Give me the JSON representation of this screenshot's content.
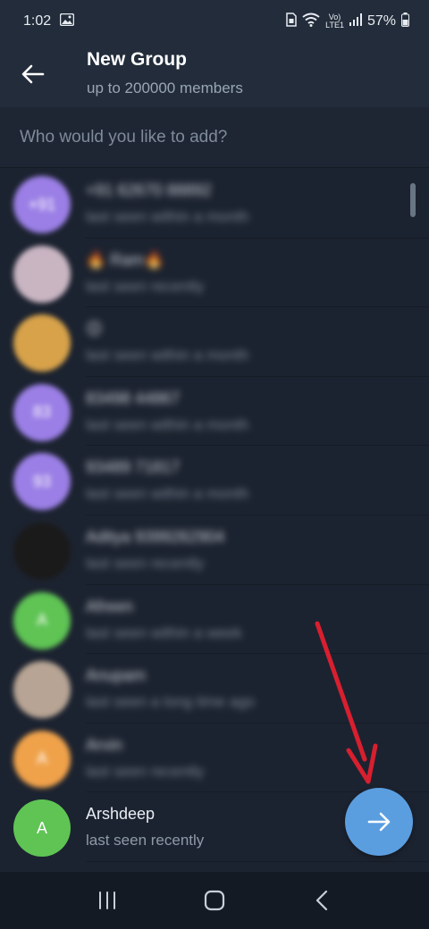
{
  "status_bar": {
    "time": "1:02",
    "volte_label": "Vo)",
    "lte_label": "LTE1",
    "battery": "57%"
  },
  "header": {
    "title": "New Group",
    "subtitle": "up to 200000 members"
  },
  "search": {
    "placeholder": "Who would you like to add?"
  },
  "contacts": [
    {
      "name": "+91 62670 88892",
      "status": "last seen within a month",
      "avatar_color": "#9b7fe6",
      "avatar_text": "+91",
      "blurred": true
    },
    {
      "name": "🔥 Ram🔥",
      "status": "last seen recently",
      "avatar_color": "#c9b5c2",
      "avatar_text": "",
      "blurred": true
    },
    {
      "name": "😊",
      "status": "last seen within a month",
      "avatar_color": "#d7a24a",
      "avatar_text": "",
      "blurred": true
    },
    {
      "name": "83498 44867",
      "status": "last seen within a month",
      "avatar_color": "#9b7fe6",
      "avatar_text": "83",
      "blurred": true
    },
    {
      "name": "93489 71817",
      "status": "last seen within a month",
      "avatar_color": "#9b7fe6",
      "avatar_text": "93",
      "blurred": true
    },
    {
      "name": "Aditya 9399262904",
      "status": "last seen recently",
      "avatar_color": "#1a1a1a",
      "avatar_text": "",
      "blurred": true
    },
    {
      "name": "Afreen",
      "status": "last seen within a week",
      "avatar_color": "#5fc454",
      "avatar_text": "A",
      "blurred": true
    },
    {
      "name": "Anupam",
      "status": "last seen a long time ago",
      "avatar_color": "#b7a494",
      "avatar_text": "",
      "blurred": true
    },
    {
      "name": "Arvin",
      "status": "last seen recently",
      "avatar_color": "#f0a24a",
      "avatar_text": "A",
      "blurred": true
    },
    {
      "name": "Arshdeep",
      "status": "last seen recently",
      "avatar_color": "#5fc454",
      "avatar_text": "A",
      "blurred": false
    }
  ],
  "colors": {
    "accent": "#5b9ee0",
    "annotation_arrow": "#d81f2f",
    "header_bg": "#222c3a",
    "list_bg": "#1c2330"
  },
  "icons": {
    "back": "arrow-left-icon",
    "fab": "arrow-right-icon",
    "nav_recents": "recents-icon",
    "nav_home": "home-icon",
    "nav_back": "chevron-left-icon"
  }
}
